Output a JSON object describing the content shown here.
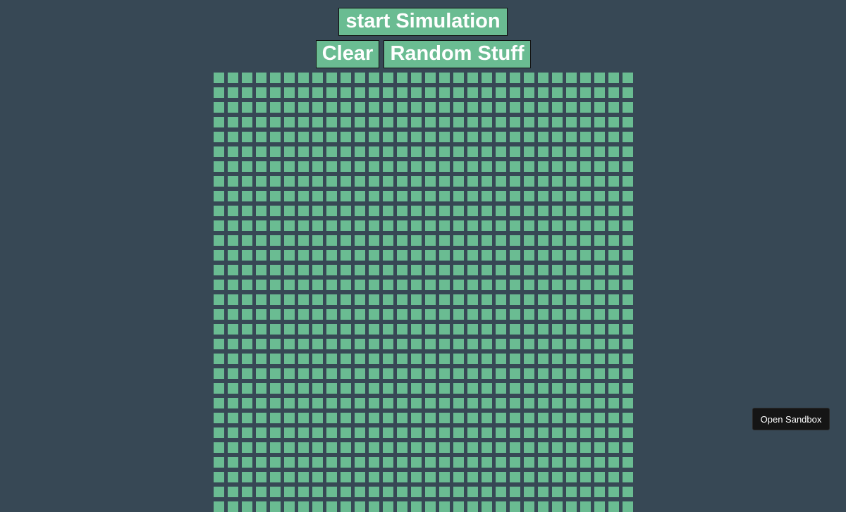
{
  "controls": {
    "start_label": "start Simulation",
    "clear_label": "Clear",
    "random_label": "Random Stuff"
  },
  "grid": {
    "columns": 30,
    "rows": 30,
    "dead_color": "#6abc92",
    "alive_color": "#111111",
    "alive_cells": []
  },
  "footer": {
    "sandbox_label": "Open Sandbox"
  },
  "colors": {
    "background": "#374855",
    "accent": "#6abc92"
  }
}
